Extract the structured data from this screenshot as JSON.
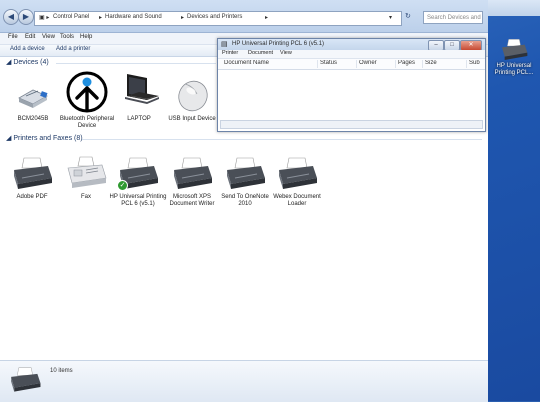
{
  "window": {
    "breadcrumb": [
      "Control Panel",
      "Hardware and Sound",
      "Devices and Printers"
    ],
    "search_placeholder": "Search Devices and Pr...",
    "back_arrow": "◀",
    "forward_arrow": "▶"
  },
  "menu": [
    "File",
    "Edit",
    "View",
    "Tools",
    "Help"
  ],
  "toolbar": {
    "add_device": "Add a device",
    "add_printer": "Add a printer"
  },
  "groups": {
    "devices": "Devices (4)",
    "printers": "Printers and Faxes (8)"
  },
  "devices": [
    {
      "label": "BCM2045B",
      "icon": "bluetooth-dongle-icon"
    },
    {
      "label": "Bluetooth Peripheral Device",
      "icon": "arrow-circle-icon"
    },
    {
      "label": "LAPTOP",
      "icon": "laptop-icon"
    },
    {
      "label": "USB Input Device",
      "icon": "mouse-icon"
    }
  ],
  "printers": [
    {
      "label": "Adobe PDF",
      "icon": "printer-icon"
    },
    {
      "label": "Fax",
      "icon": "fax-icon"
    },
    {
      "label": "HP Universal Printing PCL 6 (v5.1)",
      "icon": "printer-icon",
      "default": true
    },
    {
      "label": "Microsoft XPS Document Writer",
      "icon": "printer-icon"
    },
    {
      "label": "Send To OneNote 2010",
      "icon": "printer-icon"
    },
    {
      "label": "Webex Document Loader",
      "icon": "printer-icon"
    }
  ],
  "status": {
    "count": "10 items"
  },
  "queue_window": {
    "title": "HP Universal Printing PCL 6 (v5.1)",
    "menu": [
      "Printer",
      "Document",
      "View"
    ],
    "columns": [
      "Document Name",
      "Status",
      "Owner",
      "Pages",
      "Size",
      "Sub"
    ]
  },
  "desktop_icon": {
    "label": "HP Universal Printing PCL..."
  },
  "colors": {
    "accent": "#1e3966",
    "desktop": "#2a5fb0",
    "default_check": "#2f9a31"
  }
}
